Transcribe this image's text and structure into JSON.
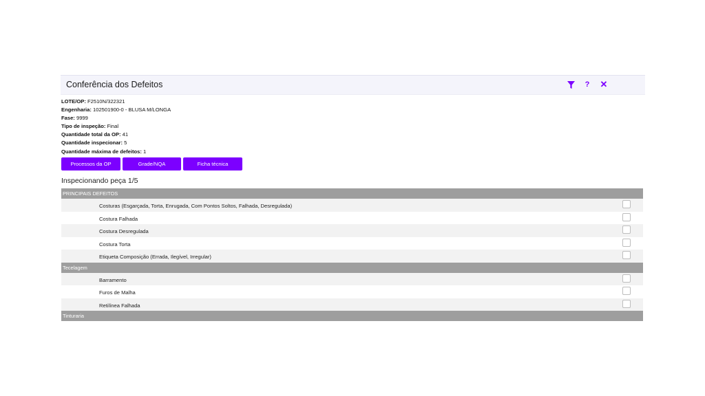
{
  "header": {
    "title": "Conferência dos Defeitos"
  },
  "info": [
    {
      "label": "LOTE/OP:",
      "value": "F2510N/322321"
    },
    {
      "label": "Engenharia:",
      "value": "102501900-0 - BLUSA M/LONGA"
    },
    {
      "label": "Fase:",
      "value": "9999"
    },
    {
      "label": "Tipo de inspeção:",
      "value": "Final"
    },
    {
      "label": "Quantidade total da OP:",
      "value": "41"
    },
    {
      "label": "Quantidade inspecionar:",
      "value": "5"
    },
    {
      "label": "Quantidade máxima de defeitos:",
      "value": "1"
    }
  ],
  "buttons": {
    "processos": "Processos da OP",
    "grade": "Grade/NQA",
    "ficha": "Ficha técnica"
  },
  "inspecting": "Inspecionando peça 1/5",
  "sections": [
    {
      "title": "PRINCIPAIS DEFEITOS",
      "items": [
        "Costuras (Esgarçada, Torta, Enrugada, Com Pontos Soltos, Falhada, Desregulada)",
        "Costura Falhada",
        "Costura Desregulada",
        "Costura Torta",
        "Etiqueta Composição (Errada, Ilegível, Irregular)"
      ]
    },
    {
      "title": "Tecelagem",
      "items": [
        "Barramento",
        "Furos de Malha",
        "Retilínea Falhada"
      ]
    },
    {
      "title": "Tinturaria",
      "items": []
    }
  ],
  "colors": {
    "accent": "#7c00ff",
    "section_bg": "#9e9e9e"
  },
  "icons": {
    "filter": "filter-icon",
    "help": "help-icon",
    "close": "close-icon"
  }
}
